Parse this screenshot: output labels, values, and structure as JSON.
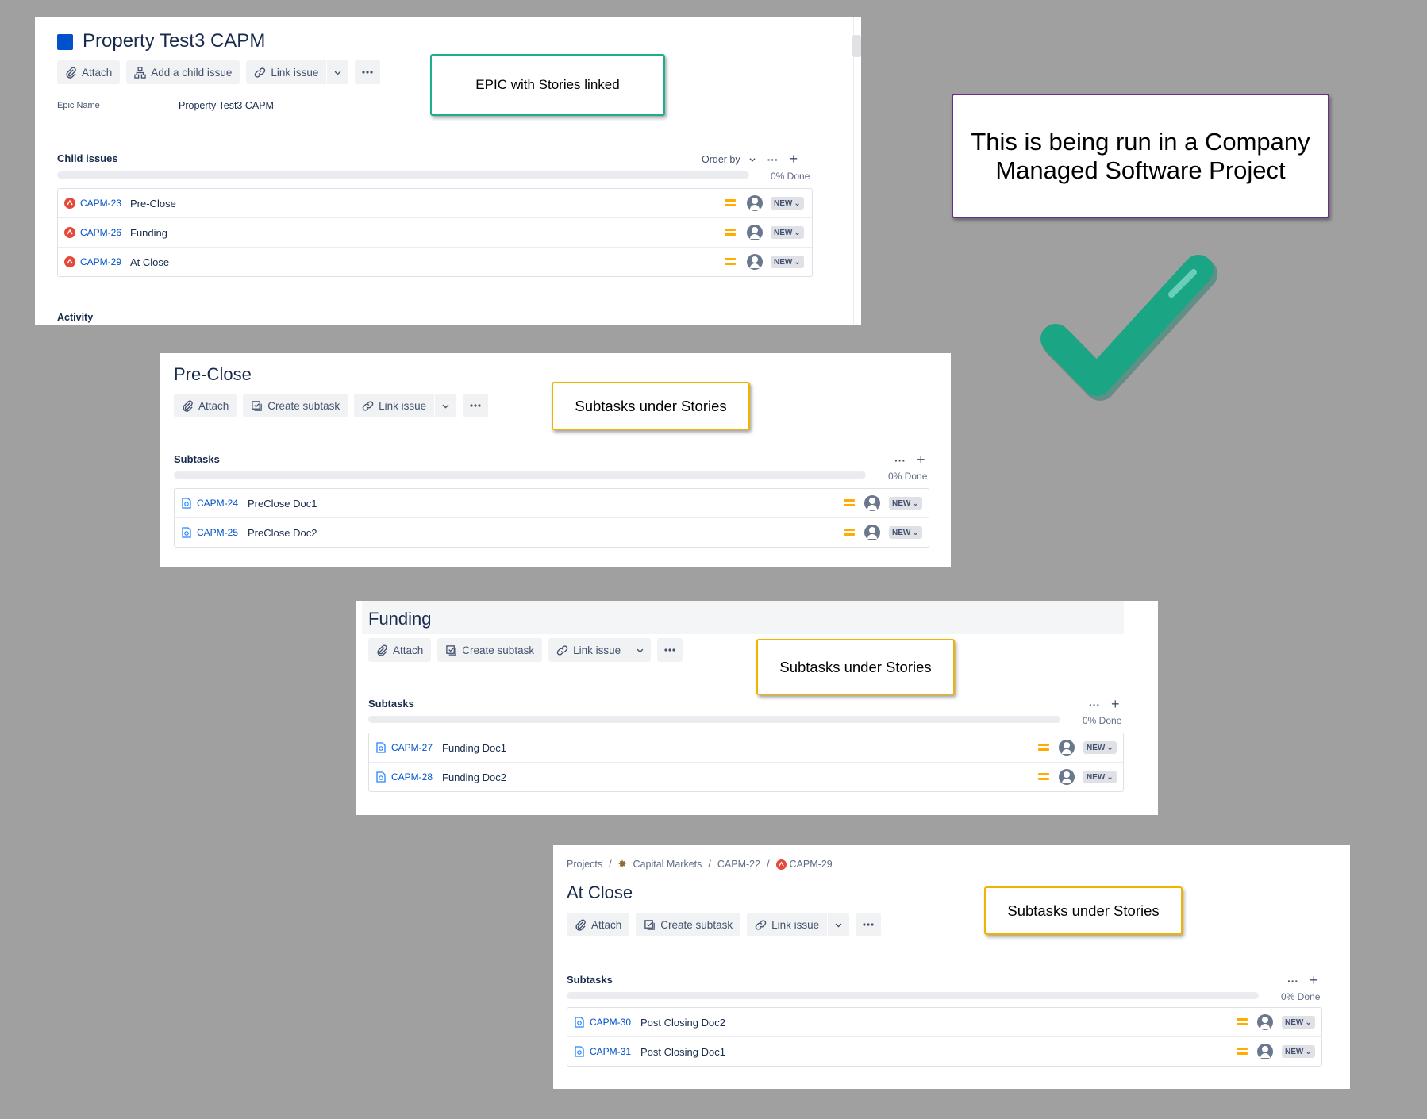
{
  "colors": {
    "background": "#a0a0a0",
    "epic_icon": "#0052cc",
    "story_icon": "#e5493a",
    "link": "#0052cc",
    "priority": "#ffab00",
    "callout_green": "#1eae8f",
    "callout_purple": "#6b2b8f",
    "callout_yellow": "#f0b400",
    "checkmark": "#1aa585"
  },
  "epic": {
    "title": "Property Test3 CAPM",
    "icon": "epic-icon",
    "toolbar": {
      "attach": "Attach",
      "add_child": "Add a child issue",
      "link_issue": "Link issue"
    },
    "epic_name_label": "Epic Name",
    "epic_name_value": "Property Test3 CAPM",
    "section_label": "Child issues",
    "order_by": "Order by",
    "progress_text": "0% Done",
    "progress": 0,
    "rows": [
      {
        "key": "CAPM-23",
        "summary": "Pre-Close",
        "priority": "medium",
        "status": "NEW"
      },
      {
        "key": "CAPM-26",
        "summary": "Funding",
        "priority": "medium",
        "status": "NEW"
      },
      {
        "key": "CAPM-29",
        "summary": "At Close",
        "priority": "medium",
        "status": "NEW"
      }
    ],
    "activity_label": "Activity"
  },
  "preclose": {
    "title": "Pre-Close",
    "toolbar": {
      "attach": "Attach",
      "create_subtask": "Create subtask",
      "link_issue": "Link issue"
    },
    "section_label": "Subtasks",
    "progress_text": "0% Done",
    "progress": 0,
    "rows": [
      {
        "key": "CAPM-24",
        "summary": "PreClose Doc1",
        "priority": "medium",
        "status": "NEW"
      },
      {
        "key": "CAPM-25",
        "summary": "PreClose Doc2",
        "priority": "medium",
        "status": "NEW"
      }
    ]
  },
  "funding": {
    "title": "Funding",
    "toolbar": {
      "attach": "Attach",
      "create_subtask": "Create subtask",
      "link_issue": "Link issue"
    },
    "section_label": "Subtasks",
    "progress_text": "0% Done",
    "progress": 0,
    "rows": [
      {
        "key": "CAPM-27",
        "summary": "Funding Doc1",
        "priority": "medium",
        "status": "NEW"
      },
      {
        "key": "CAPM-28",
        "summary": "Funding Doc2",
        "priority": "medium",
        "status": "NEW"
      }
    ]
  },
  "atclose": {
    "breadcrumb": {
      "projects": "Projects",
      "project": "Capital Markets",
      "parent": "CAPM-22",
      "current": "CAPM-29"
    },
    "title": "At Close",
    "toolbar": {
      "attach": "Attach",
      "create_subtask": "Create subtask",
      "link_issue": "Link issue"
    },
    "section_label": "Subtasks",
    "progress_text": "0% Done",
    "progress": 0,
    "rows": [
      {
        "key": "CAPM-30",
        "summary": "Post Closing Doc2",
        "priority": "medium",
        "status": "NEW"
      },
      {
        "key": "CAPM-31",
        "summary": "Post Closing Doc1",
        "priority": "medium",
        "status": "NEW"
      }
    ]
  },
  "callouts": {
    "epic": "EPIC with Stories linked",
    "company": "This is being run in a Company Managed Software Project",
    "sub1": "Subtasks under Stories",
    "sub2": "Subtasks under Stories",
    "sub3": "Subtasks under Stories"
  }
}
